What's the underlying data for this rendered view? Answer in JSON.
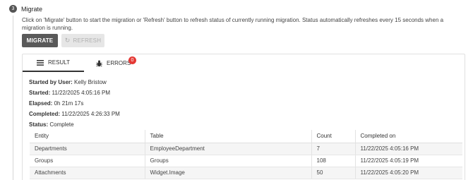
{
  "step": {
    "number": "3",
    "title": "Migrate"
  },
  "description": "Click on 'Migrate' button to start the migration or 'Refresh' button to refresh status of currently running migration. Status automatically refreshes every 15 seconds when a migration is running.",
  "buttons": {
    "migrate": "MIGRATE",
    "refresh": "REFRESH"
  },
  "tabs": {
    "result": "RESULT",
    "errors": "ERRORS",
    "errors_count": "0"
  },
  "info": {
    "started_by_label": "Started by User:",
    "started_by": "Kelly Bristow",
    "started_label": "Started:",
    "started": "11/22/2025 4:05:16 PM",
    "elapsed_label": "Elapsed:",
    "elapsed": "0h 21m 17s",
    "completed_label": "Completed:",
    "completed": "11/22/2025 4:26:33 PM",
    "status_label": "Status:",
    "status": "Complete"
  },
  "table": {
    "headers": [
      "Entity",
      "Table",
      "Count",
      "Completed on"
    ],
    "rows": [
      [
        "Departments",
        "EmployeeDepartment",
        "7",
        "11/22/2025 4:05:16 PM"
      ],
      [
        "Groups",
        "Groups",
        "108",
        "11/22/2025 4:05:19 PM"
      ],
      [
        "Attachments",
        "Widget.Image",
        "50",
        "11/22/2025 4:05:20 PM"
      ]
    ]
  }
}
